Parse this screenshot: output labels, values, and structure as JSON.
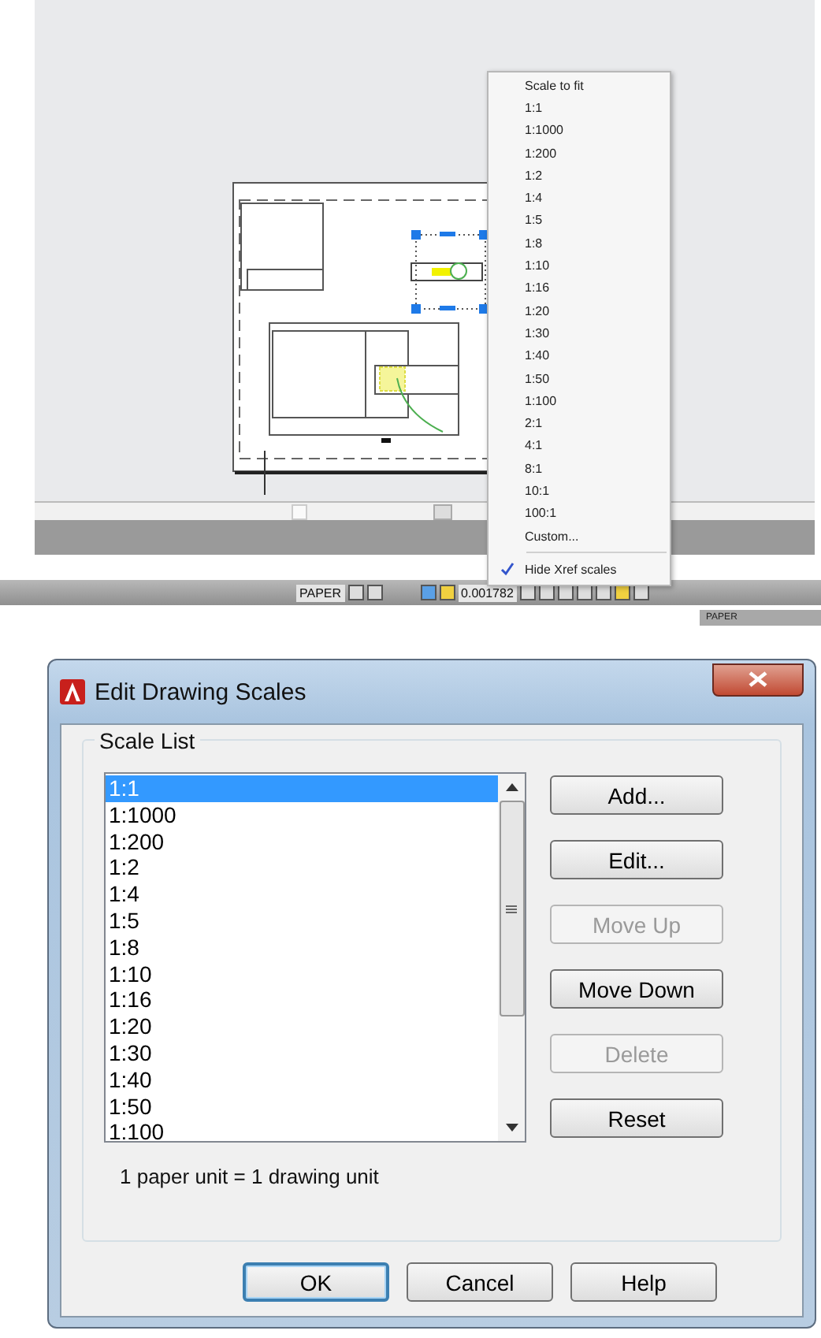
{
  "context_menu": {
    "items": [
      {
        "label": "Scale to fit",
        "kind": "option",
        "checked": false
      },
      {
        "label": "1:1",
        "kind": "option",
        "checked": false
      },
      {
        "label": "1:1000",
        "kind": "option",
        "checked": false
      },
      {
        "label": "1:200",
        "kind": "option",
        "checked": false
      },
      {
        "label": "1:2",
        "kind": "option",
        "checked": false
      },
      {
        "label": "1:4",
        "kind": "option",
        "checked": false
      },
      {
        "label": "1:5",
        "kind": "option",
        "checked": false
      },
      {
        "label": "1:8",
        "kind": "option",
        "checked": false
      },
      {
        "label": "1:10",
        "kind": "option",
        "checked": false
      },
      {
        "label": "1:16",
        "kind": "option",
        "checked": false
      },
      {
        "label": "1:20",
        "kind": "option",
        "checked": false
      },
      {
        "label": "1:30",
        "kind": "option",
        "checked": false
      },
      {
        "label": "1:40",
        "kind": "option",
        "checked": false
      },
      {
        "label": "1:50",
        "kind": "option",
        "checked": false
      },
      {
        "label": "1:100",
        "kind": "option",
        "checked": false
      },
      {
        "label": "2:1",
        "kind": "option",
        "checked": false
      },
      {
        "label": "4:1",
        "kind": "option",
        "checked": false
      },
      {
        "label": "8:1",
        "kind": "option",
        "checked": false
      },
      {
        "label": "10:1",
        "kind": "option",
        "checked": false
      },
      {
        "label": "100:1",
        "kind": "option",
        "checked": false
      },
      {
        "label": "Custom...",
        "kind": "option",
        "checked": false
      },
      {
        "label": "Hide Xref scales",
        "kind": "toggle",
        "checked": true
      }
    ]
  },
  "status_bar": {
    "paper_label": "PAPER",
    "scale_value": "0.001782"
  },
  "mini_status_bar": {
    "paper_label": "PAPER"
  },
  "dialog": {
    "title": "Edit Drawing Scales",
    "group_title": "Scale List",
    "scales": [
      {
        "label": "1:1",
        "selected": true
      },
      {
        "label": "1:1000",
        "selected": false
      },
      {
        "label": "1:200",
        "selected": false
      },
      {
        "label": "1:2",
        "selected": false
      },
      {
        "label": "1:4",
        "selected": false
      },
      {
        "label": "1:5",
        "selected": false
      },
      {
        "label": "1:8",
        "selected": false
      },
      {
        "label": "1:10",
        "selected": false
      },
      {
        "label": "1:16",
        "selected": false
      },
      {
        "label": "1:20",
        "selected": false
      },
      {
        "label": "1:30",
        "selected": false
      },
      {
        "label": "1:40",
        "selected": false
      },
      {
        "label": "1:50",
        "selected": false
      },
      {
        "label": "1:100",
        "selected": false
      }
    ],
    "side_buttons": [
      {
        "label": "Add...",
        "disabled": false
      },
      {
        "label": "Edit...",
        "disabled": false
      },
      {
        "label": "Move Up",
        "disabled": true
      },
      {
        "label": "Move Down",
        "disabled": false
      },
      {
        "label": "Delete",
        "disabled": true
      },
      {
        "label": "Reset",
        "disabled": false
      }
    ],
    "unit_text": "1 paper unit = 1 drawing unit",
    "footer_buttons": [
      {
        "label": "OK",
        "default": true
      },
      {
        "label": "Cancel",
        "default": false
      },
      {
        "label": "Help",
        "default": false
      }
    ]
  }
}
